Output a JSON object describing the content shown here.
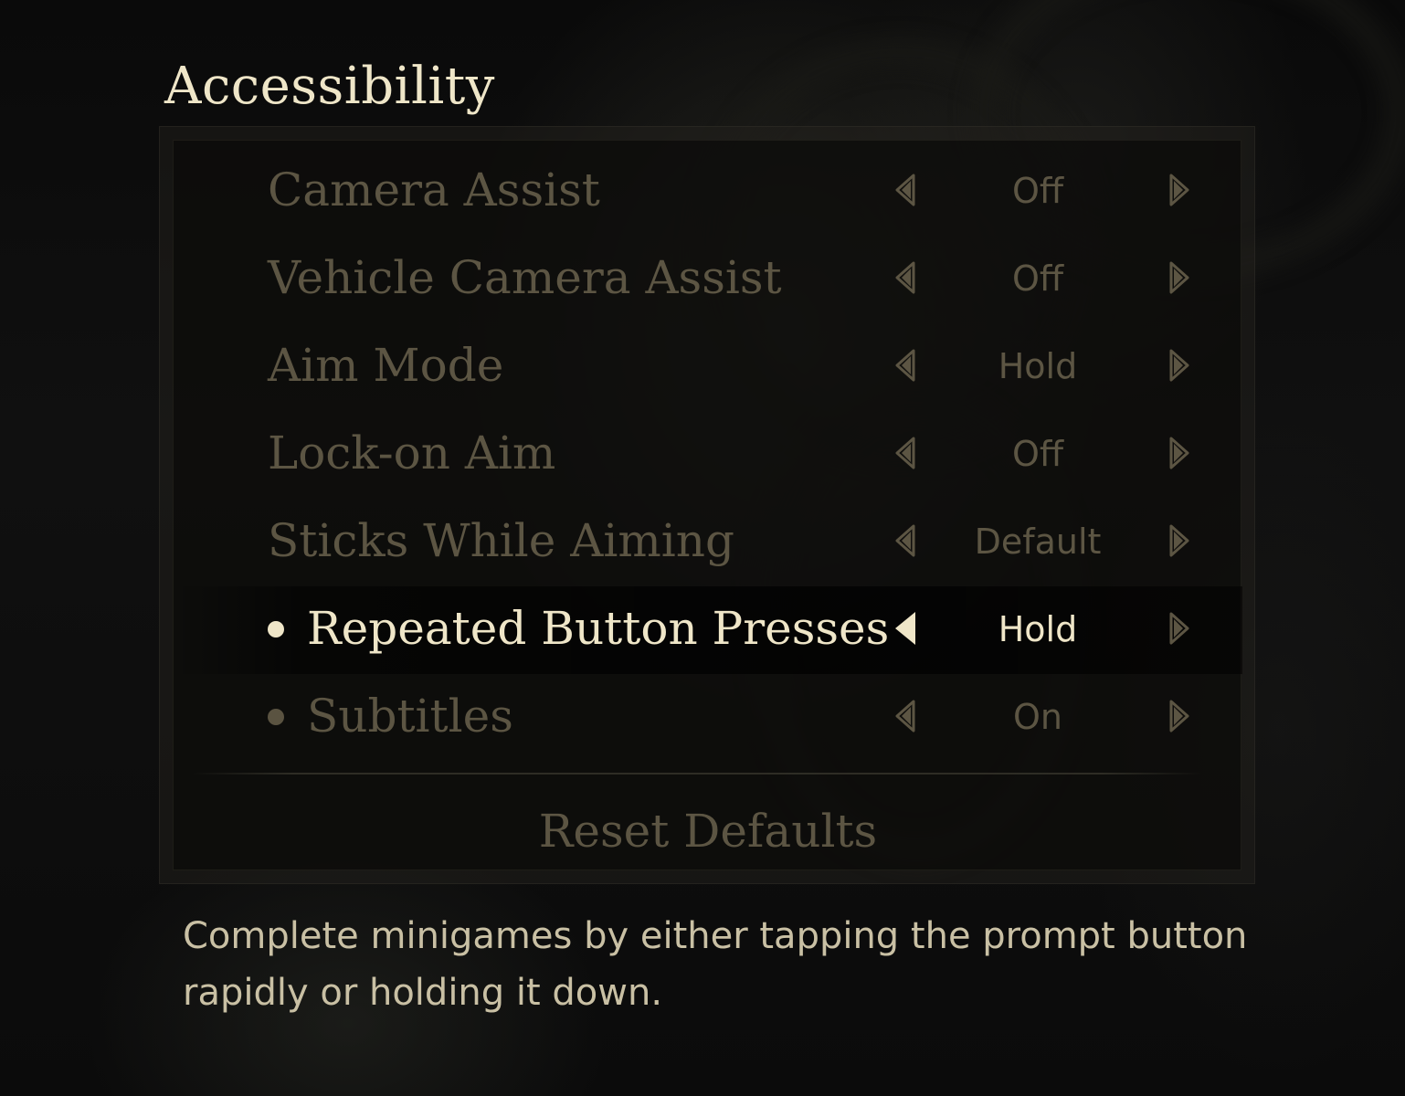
{
  "page_title": "Accessibility",
  "settings": [
    {
      "label": "Camera Assist",
      "value": "Off",
      "bullet": false,
      "active": false
    },
    {
      "label": "Vehicle Camera Assist",
      "value": "Off",
      "bullet": false,
      "active": false
    },
    {
      "label": "Aim Mode",
      "value": "Hold",
      "bullet": false,
      "active": false
    },
    {
      "label": "Lock-on Aim",
      "value": "Off",
      "bullet": false,
      "active": false
    },
    {
      "label": "Sticks While Aiming",
      "value": "Default",
      "bullet": false,
      "active": false
    },
    {
      "label": "Repeated Button Presses",
      "value": "Hold",
      "bullet": true,
      "active": true
    },
    {
      "label": "Subtitles",
      "value": "On",
      "bullet": true,
      "active": false
    }
  ],
  "reset_label": "Reset Defaults",
  "description": "Complete minigames by either tapping the prompt button rapidly or holding it down.",
  "colors": {
    "active_text": "#efe6c8",
    "inactive_text": "#5c5543",
    "description_text": "#c9c0a4"
  },
  "icons": {
    "previous": "triangle-left-icon",
    "next": "triangle-right-icon"
  }
}
